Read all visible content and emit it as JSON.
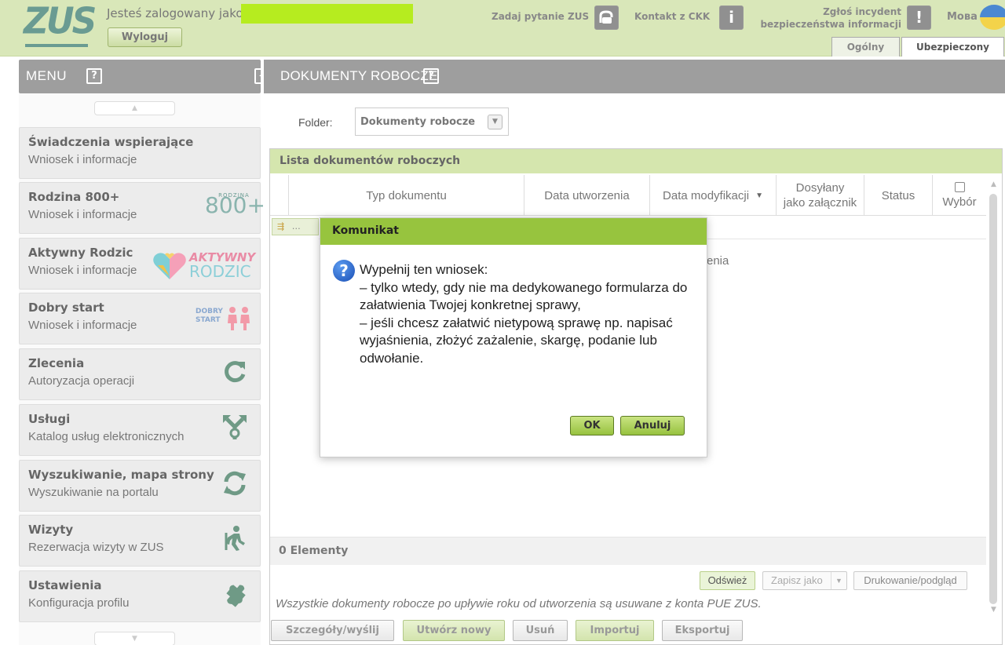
{
  "header": {
    "logo_text": "ZUS",
    "logged_label": "Jesteś zalogowany jako:",
    "logout_label": "Wyloguj",
    "ask_label": "Zadaj pytanie ZUS",
    "ckk_label": "Kontakt z CKK",
    "incident_label_line1": "Zgłoś incydent",
    "incident_label_line2": "bezpieczeństwa informacji",
    "lang_label": "Мова",
    "tabs": [
      {
        "label": "Ogólny",
        "active": false
      },
      {
        "label": "Ubezpieczony",
        "active": true
      }
    ],
    "mask_color": "#b6ec1f"
  },
  "sidebar": {
    "title": "MENU",
    "help_glyph": "?",
    "items": [
      {
        "title": "Świadczenia wspierające",
        "subtitle": "Wniosek i informacje",
        "icon": ""
      },
      {
        "title": "Rodzina 800+",
        "subtitle": "Wniosek i informacje",
        "icon": "rodzina-800-logo",
        "badge_small": "RODZINA",
        "badge_big": "800+"
      },
      {
        "title": "Aktywny Rodzic",
        "subtitle": "Wniosek i informacje",
        "icon": "aktywny-rodzic-logo",
        "badge_line1": "AKTYWNY",
        "badge_line2": "RODZIC"
      },
      {
        "title": "Dobry start",
        "subtitle": "Wniosek i informacje",
        "icon": "dobry-start-logo",
        "badge_line1": "DOBRY",
        "badge_line2": "START"
      },
      {
        "title": "Zlecenia",
        "subtitle": "Autoryzacja operacji",
        "icon": "refresh-arrow-icon"
      },
      {
        "title": "Usługi",
        "subtitle": "Katalog usług elektronicznych",
        "icon": "services-arrows-icon"
      },
      {
        "title": "Wyszukiwanie, mapa strony",
        "subtitle": "Wyszukiwanie na portalu",
        "icon": "sync-arrows-icon"
      },
      {
        "title": "Wizyty",
        "subtitle": "Rezerwacja wizyty w ZUS",
        "icon": "walking-person-icon"
      },
      {
        "title": "Ustawienia",
        "subtitle": "Konfiguracja profilu",
        "icon": "puzzle-icon"
      }
    ]
  },
  "main": {
    "title": "DOKUMENTY ROBOCZE",
    "folder_label": "Folder:",
    "folder_value": "Dokumenty robocze",
    "list_title": "Lista dokumentów roboczych",
    "columns": {
      "type": "Typ dokumentu",
      "created": "Data utworzenia",
      "modified": "Data modyfikacji",
      "attach_line1": "Dosyłany",
      "attach_line2": "jako załącznik",
      "status": "Status",
      "select": "Wybór"
    },
    "filter_glyph": "…",
    "empty_message_fragment": "enia",
    "count_label": "0 Elementy",
    "refresh_label": "Odśwież",
    "saveas_label": "Zapisz jako",
    "print_label": "Drukowanie/podgląd",
    "notice": "Wszystkie dokumenty robocze po upływie roku od utworzenia są usuwane z konta PUE ZUS.",
    "actions": {
      "details": "Szczegóły/wyślij",
      "create": "Utwórz nowy",
      "delete": "Usuń",
      "import": "Importuj",
      "export": "Eksportuj"
    }
  },
  "dialog": {
    "title": "Komunikat",
    "message": "Wypełnij ten wniosek:\n – tylko wtedy, gdy nie ma dedykowanego formularza do załatwienia Twojej konkretnej sprawy,\n – jeśli chcesz załatwić nietypową sprawę np. napisać wyjaśnienia, złożyć zażalenie, skargę, podanie lub odwołanie.",
    "ok_label": "OK",
    "cancel_label": "Anuluj",
    "accent_color": "#97c43e"
  }
}
